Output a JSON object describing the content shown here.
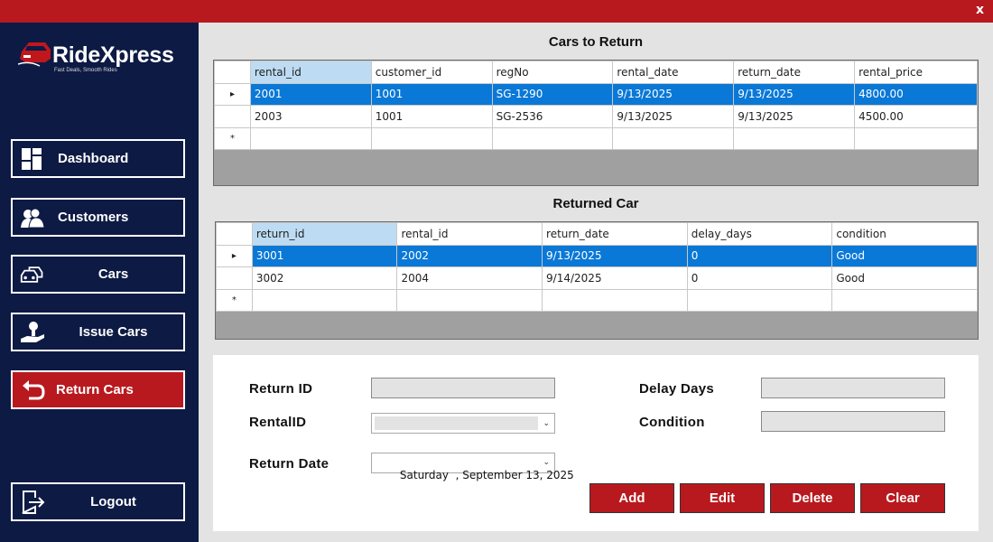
{
  "window": {
    "close_label": "x"
  },
  "brand": {
    "name": "RideXpress",
    "tagline": "Fast Deals, Smooth Rides"
  },
  "sidebar": {
    "items": [
      {
        "label": "Dashboard",
        "icon": "dashboard-icon"
      },
      {
        "label": "Customers",
        "icon": "users-icon"
      },
      {
        "label": "Cars",
        "icon": "cars-icon"
      },
      {
        "label": "Issue Cars",
        "icon": "issue-car-icon"
      },
      {
        "label": "Return Cars",
        "icon": "return-icon",
        "active": true
      }
    ],
    "logout_label": "Logout"
  },
  "cars_to_return": {
    "title": "Cars to Return",
    "columns": [
      "rental_id",
      "customer_id",
      "regNo",
      "rental_date",
      "return_date",
      "rental_price"
    ],
    "rows": [
      [
        "2001",
        "1001",
        "SG-1290",
        "9/13/2025",
        "9/13/2025",
        "4800.00"
      ],
      [
        "2003",
        "1001",
        "SG-2536",
        "9/13/2025",
        "9/13/2025",
        "4500.00"
      ]
    ],
    "new_row_marker": "*",
    "current_row_marker": "▸"
  },
  "returned_car": {
    "title": "Returned Car",
    "columns": [
      "return_id",
      "rental_id",
      "return_date",
      "delay_days",
      "condition"
    ],
    "rows": [
      [
        "3001",
        "2002",
        "9/13/2025",
        "0",
        "Good"
      ],
      [
        "3002",
        "2004",
        "9/14/2025",
        "0",
        "Good"
      ]
    ],
    "new_row_marker": "*",
    "current_row_marker": "▸"
  },
  "form": {
    "return_id_label": "Return ID",
    "rental_id_label": "RentalID",
    "return_date_label": "Return Date",
    "return_date_value": "Saturday  , September 13, 2025",
    "delay_days_label": "Delay Days",
    "condition_label": "Condition"
  },
  "actions": {
    "add": "Add",
    "edit": "Edit",
    "delete": "Delete",
    "clear": "Clear"
  },
  "colors": {
    "brand_red": "#b8191e",
    "sidebar_navy": "#0d1a44",
    "selection_blue": "#0a78d7",
    "header_highlight": "#bddcf3"
  }
}
